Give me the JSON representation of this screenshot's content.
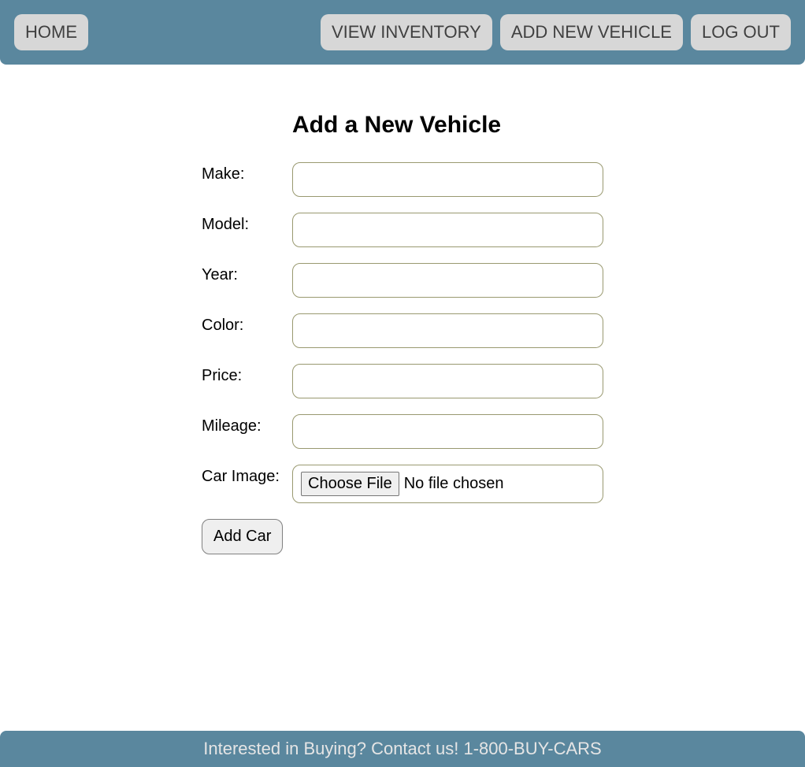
{
  "nav": {
    "home": "HOME",
    "view_inventory": "VIEW INVENTORY",
    "add_new_vehicle": "ADD NEW VEHICLE",
    "log_out": "LOG OUT"
  },
  "page": {
    "title": "Add a New Vehicle"
  },
  "form": {
    "labels": {
      "make": "Make:",
      "model": "Model:",
      "year": "Year:",
      "color": "Color:",
      "price": "Price:",
      "mileage": "Mileage:",
      "car_image": "Car Image:"
    },
    "file_button": "Choose File",
    "file_status": "No file chosen",
    "submit": "Add Car"
  },
  "footer": {
    "text": "Interested in Buying? Contact us! 1-800-BUY-CARS"
  }
}
